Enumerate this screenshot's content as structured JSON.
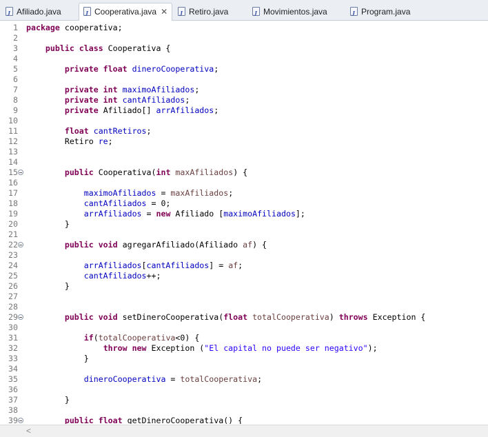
{
  "tabs": [
    {
      "label": "Afiliado.java",
      "active": false
    },
    {
      "label": "Cooperativa.java",
      "active": true,
      "close": "✕"
    },
    {
      "label": "Retiro.java",
      "active": false
    },
    {
      "label": "Movimientos.java",
      "active": false
    },
    {
      "label": "Program.java",
      "active": false
    }
  ],
  "colors": {
    "keyword": "#7f0055",
    "field": "#0000c0",
    "parameter": "#6a3e3e",
    "string": "#2a00ff",
    "line_number": "#787878"
  },
  "editor": {
    "lines": [
      {
        "n": "1",
        "fold": false,
        "tokens": [
          [
            "kw",
            "package"
          ],
          [
            "",
            " cooperativa;"
          ]
        ]
      },
      {
        "n": "2",
        "fold": false,
        "tokens": []
      },
      {
        "n": "3",
        "fold": false,
        "tokens": [
          [
            "",
            "    "
          ],
          [
            "kw",
            "public class"
          ],
          [
            "",
            " Cooperativa {"
          ]
        ]
      },
      {
        "n": "4",
        "fold": false,
        "tokens": []
      },
      {
        "n": "5",
        "fold": false,
        "tokens": [
          [
            "",
            "        "
          ],
          [
            "kw",
            "private float"
          ],
          [
            "",
            " "
          ],
          [
            "fd",
            "dineroCooperativa"
          ],
          [
            "",
            ";"
          ]
        ]
      },
      {
        "n": "6",
        "fold": false,
        "tokens": []
      },
      {
        "n": "7",
        "fold": false,
        "tokens": [
          [
            "",
            "        "
          ],
          [
            "kw",
            "private int"
          ],
          [
            "",
            " "
          ],
          [
            "fd",
            "maximoAfiliados"
          ],
          [
            "",
            ";"
          ]
        ]
      },
      {
        "n": "8",
        "fold": false,
        "tokens": [
          [
            "",
            "        "
          ],
          [
            "kw",
            "private int"
          ],
          [
            "",
            " "
          ],
          [
            "fd",
            "cantAfiliados"
          ],
          [
            "",
            ";"
          ]
        ]
      },
      {
        "n": "9",
        "fold": false,
        "tokens": [
          [
            "",
            "        "
          ],
          [
            "kw",
            "private"
          ],
          [
            "",
            " Afiliado[] "
          ],
          [
            "fd",
            "arrAfiliados"
          ],
          [
            "",
            ";"
          ]
        ]
      },
      {
        "n": "10",
        "fold": false,
        "tokens": []
      },
      {
        "n": "11",
        "fold": false,
        "tokens": [
          [
            "",
            "        "
          ],
          [
            "kw",
            "float"
          ],
          [
            "",
            " "
          ],
          [
            "fd",
            "cantRetiros"
          ],
          [
            "",
            ";"
          ]
        ]
      },
      {
        "n": "12",
        "fold": false,
        "tokens": [
          [
            "",
            "        Retiro "
          ],
          [
            "fd",
            "re"
          ],
          [
            "",
            ";"
          ]
        ]
      },
      {
        "n": "13",
        "fold": false,
        "tokens": []
      },
      {
        "n": "14",
        "fold": false,
        "tokens": []
      },
      {
        "n": "15",
        "fold": true,
        "tokens": [
          [
            "",
            "        "
          ],
          [
            "kw",
            "public"
          ],
          [
            "",
            " Cooperativa("
          ],
          [
            "kw",
            "int"
          ],
          [
            "",
            " "
          ],
          [
            "pm",
            "maxAfiliados"
          ],
          [
            "",
            ") {"
          ]
        ]
      },
      {
        "n": "16",
        "fold": false,
        "tokens": []
      },
      {
        "n": "17",
        "fold": false,
        "tokens": [
          [
            "",
            "            "
          ],
          [
            "fd",
            "maximoAfiliados"
          ],
          [
            "",
            " = "
          ],
          [
            "pm",
            "maxAfiliados"
          ],
          [
            "",
            ";"
          ]
        ]
      },
      {
        "n": "18",
        "fold": false,
        "tokens": [
          [
            "",
            "            "
          ],
          [
            "fd",
            "cantAfiliados"
          ],
          [
            "",
            " = 0;"
          ]
        ]
      },
      {
        "n": "19",
        "fold": false,
        "tokens": [
          [
            "",
            "            "
          ],
          [
            "fd",
            "arrAfiliados"
          ],
          [
            "",
            " = "
          ],
          [
            "kw",
            "new"
          ],
          [
            "",
            " Afiliado ["
          ],
          [
            "fd",
            "maximoAfiliados"
          ],
          [
            "",
            "];"
          ]
        ]
      },
      {
        "n": "20",
        "fold": false,
        "tokens": [
          [
            "",
            "        }"
          ]
        ]
      },
      {
        "n": "21",
        "fold": false,
        "tokens": []
      },
      {
        "n": "22",
        "fold": true,
        "tokens": [
          [
            "",
            "        "
          ],
          [
            "kw",
            "public void"
          ],
          [
            "",
            " agregarAfiliado(Afiliado "
          ],
          [
            "pm",
            "af"
          ],
          [
            "",
            ") {"
          ]
        ]
      },
      {
        "n": "23",
        "fold": false,
        "tokens": []
      },
      {
        "n": "24",
        "fold": false,
        "tokens": [
          [
            "",
            "            "
          ],
          [
            "fd",
            "arrAfiliados"
          ],
          [
            "",
            "["
          ],
          [
            "fd",
            "cantAfiliados"
          ],
          [
            "",
            "] = "
          ],
          [
            "pm",
            "af"
          ],
          [
            "",
            ";"
          ]
        ]
      },
      {
        "n": "25",
        "fold": false,
        "tokens": [
          [
            "",
            "            "
          ],
          [
            "fd",
            "cantAfiliados"
          ],
          [
            "",
            "++;"
          ]
        ]
      },
      {
        "n": "26",
        "fold": false,
        "tokens": [
          [
            "",
            "        }"
          ]
        ]
      },
      {
        "n": "27",
        "fold": false,
        "tokens": []
      },
      {
        "n": "28",
        "fold": false,
        "tokens": []
      },
      {
        "n": "29",
        "fold": true,
        "tokens": [
          [
            "",
            "        "
          ],
          [
            "kw",
            "public void"
          ],
          [
            "",
            " setDineroCooperativa("
          ],
          [
            "kw",
            "float"
          ],
          [
            "",
            " "
          ],
          [
            "pm",
            "totalCooperativa"
          ],
          [
            "",
            ") "
          ],
          [
            "kw",
            "throws"
          ],
          [
            "",
            " Exception {"
          ]
        ]
      },
      {
        "n": "30",
        "fold": false,
        "tokens": []
      },
      {
        "n": "31",
        "fold": false,
        "tokens": [
          [
            "",
            "            "
          ],
          [
            "kw",
            "if"
          ],
          [
            "",
            "("
          ],
          [
            "pm",
            "totalCooperativa"
          ],
          [
            "",
            "<0) {"
          ]
        ]
      },
      {
        "n": "32",
        "fold": false,
        "tokens": [
          [
            "",
            "                "
          ],
          [
            "kw",
            "throw new"
          ],
          [
            "",
            " Exception ("
          ],
          [
            "st",
            "\"El capital no puede ser negativo\""
          ],
          [
            "",
            ");"
          ]
        ]
      },
      {
        "n": "33",
        "fold": false,
        "tokens": [
          [
            "",
            "            }"
          ]
        ]
      },
      {
        "n": "34",
        "fold": false,
        "tokens": []
      },
      {
        "n": "35",
        "fold": false,
        "tokens": [
          [
            "",
            "            "
          ],
          [
            "fd",
            "dineroCooperativa"
          ],
          [
            "",
            " = "
          ],
          [
            "pm",
            "totalCooperativa"
          ],
          [
            "",
            ";"
          ]
        ]
      },
      {
        "n": "36",
        "fold": false,
        "tokens": []
      },
      {
        "n": "37",
        "fold": false,
        "tokens": [
          [
            "",
            "        }"
          ]
        ]
      },
      {
        "n": "38",
        "fold": false,
        "tokens": []
      },
      {
        "n": "39",
        "fold": true,
        "tokens": [
          [
            "",
            "        "
          ],
          [
            "kw",
            "public float"
          ],
          [
            "",
            " getDineroCooperativa() {"
          ]
        ]
      }
    ]
  },
  "scrollbar": {
    "left_arrow": "<"
  }
}
